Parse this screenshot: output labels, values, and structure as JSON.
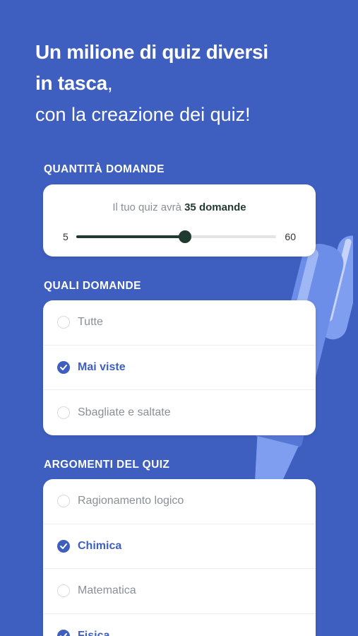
{
  "headline": {
    "bold_line1": "Un milione di quiz diversi",
    "bold_line2": "in tasca",
    "comma": ",",
    "light_line": "con la creazione dei quiz!"
  },
  "quantity": {
    "section_title": "QUANTITÀ DOMANDE",
    "caption_prefix": "Il tuo quiz avrà",
    "caption_value": "35 domande",
    "min_label": "5",
    "max_label": "60",
    "value": 35,
    "min": 5,
    "max": 60
  },
  "which": {
    "section_title": "QUALI DOMANDE",
    "options": [
      {
        "label": "Tutte",
        "selected": false
      },
      {
        "label": "Mai viste",
        "selected": true
      },
      {
        "label": "Sbagliate e saltate",
        "selected": false
      }
    ]
  },
  "topics": {
    "section_title": "ARGOMENTI DEL QUIZ",
    "options": [
      {
        "label": "Ragionamento logico",
        "selected": false
      },
      {
        "label": "Chimica",
        "selected": true
      },
      {
        "label": "Matematica",
        "selected": false
      },
      {
        "label": "Fisica",
        "selected": true
      }
    ]
  },
  "colors": {
    "background": "#3e5fc0",
    "accent": "#3e5fc0",
    "slider": "#1f3a2e"
  }
}
